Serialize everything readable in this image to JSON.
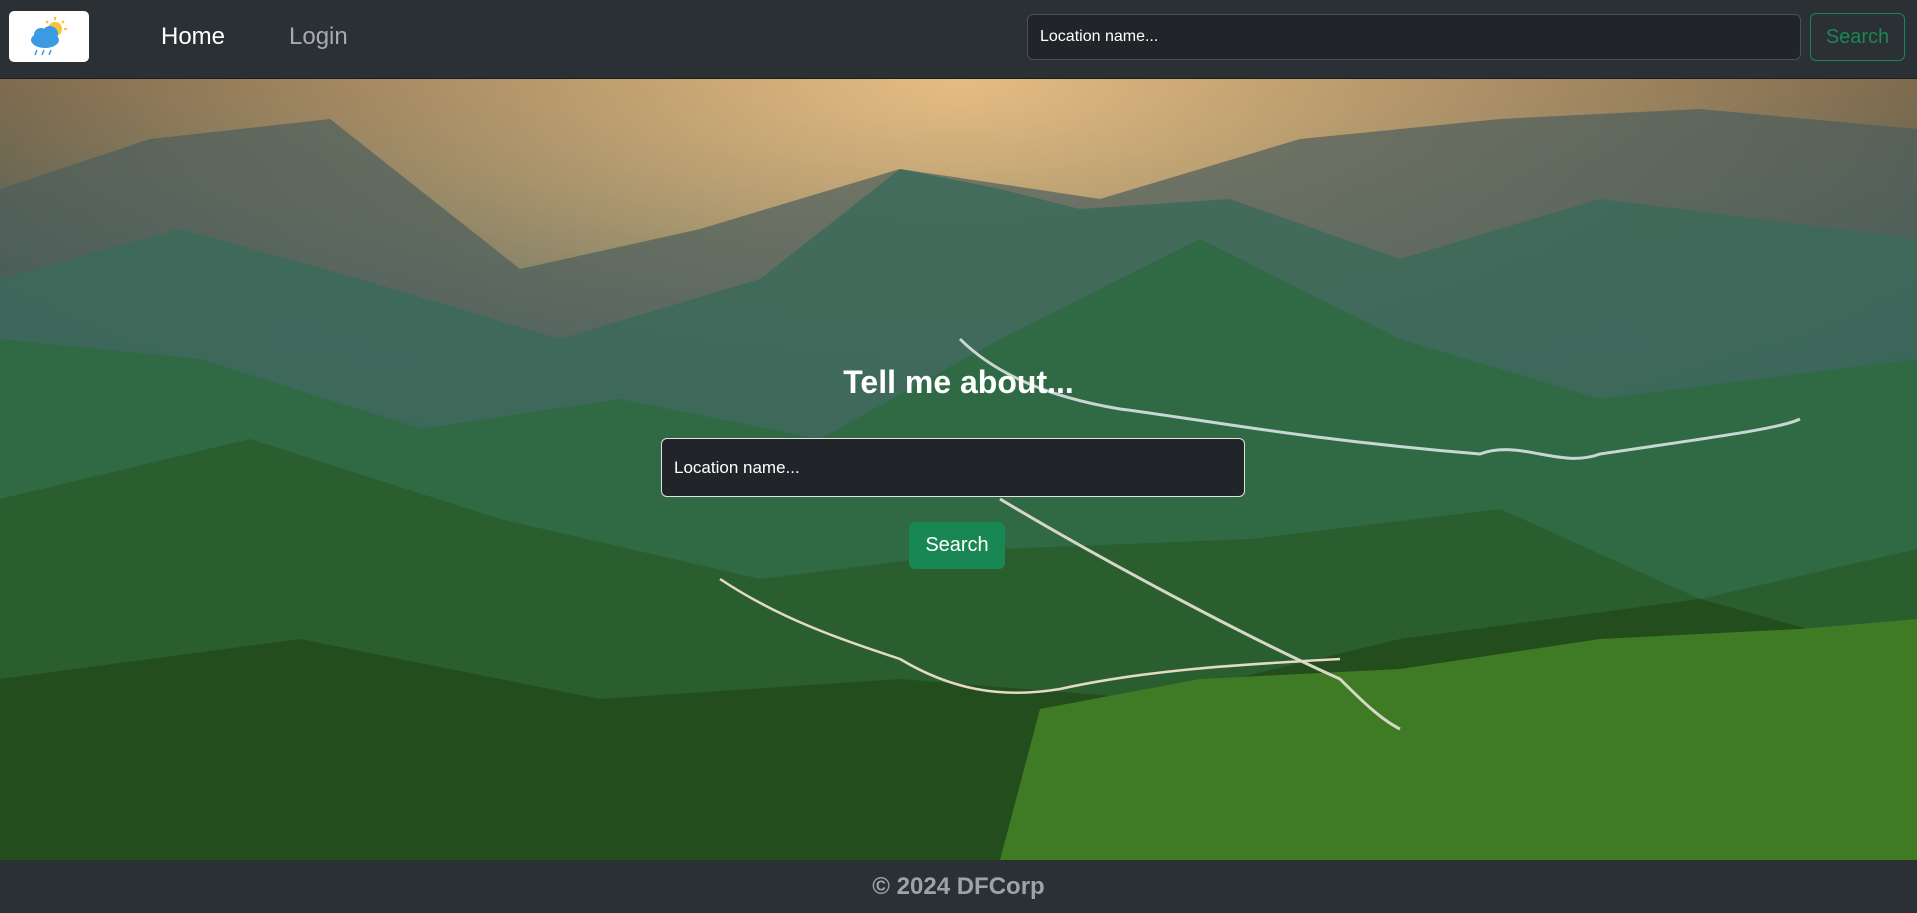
{
  "navbar": {
    "logo_icon": "weather-cloud-sun-rain-icon",
    "links": [
      {
        "label": "Home",
        "active": true
      },
      {
        "label": "Login",
        "active": false
      }
    ],
    "search": {
      "placeholder": "Location name...",
      "value": "",
      "button_label": "Search"
    }
  },
  "hero": {
    "title": "Tell me about...",
    "search": {
      "placeholder": "Location name...",
      "value": "",
      "button_label": "Search"
    }
  },
  "footer": {
    "text": "© 2024 DFCorp"
  },
  "colors": {
    "navbar_bg": "#2b3035",
    "accent_green": "#198754",
    "input_bg": "#212529"
  }
}
